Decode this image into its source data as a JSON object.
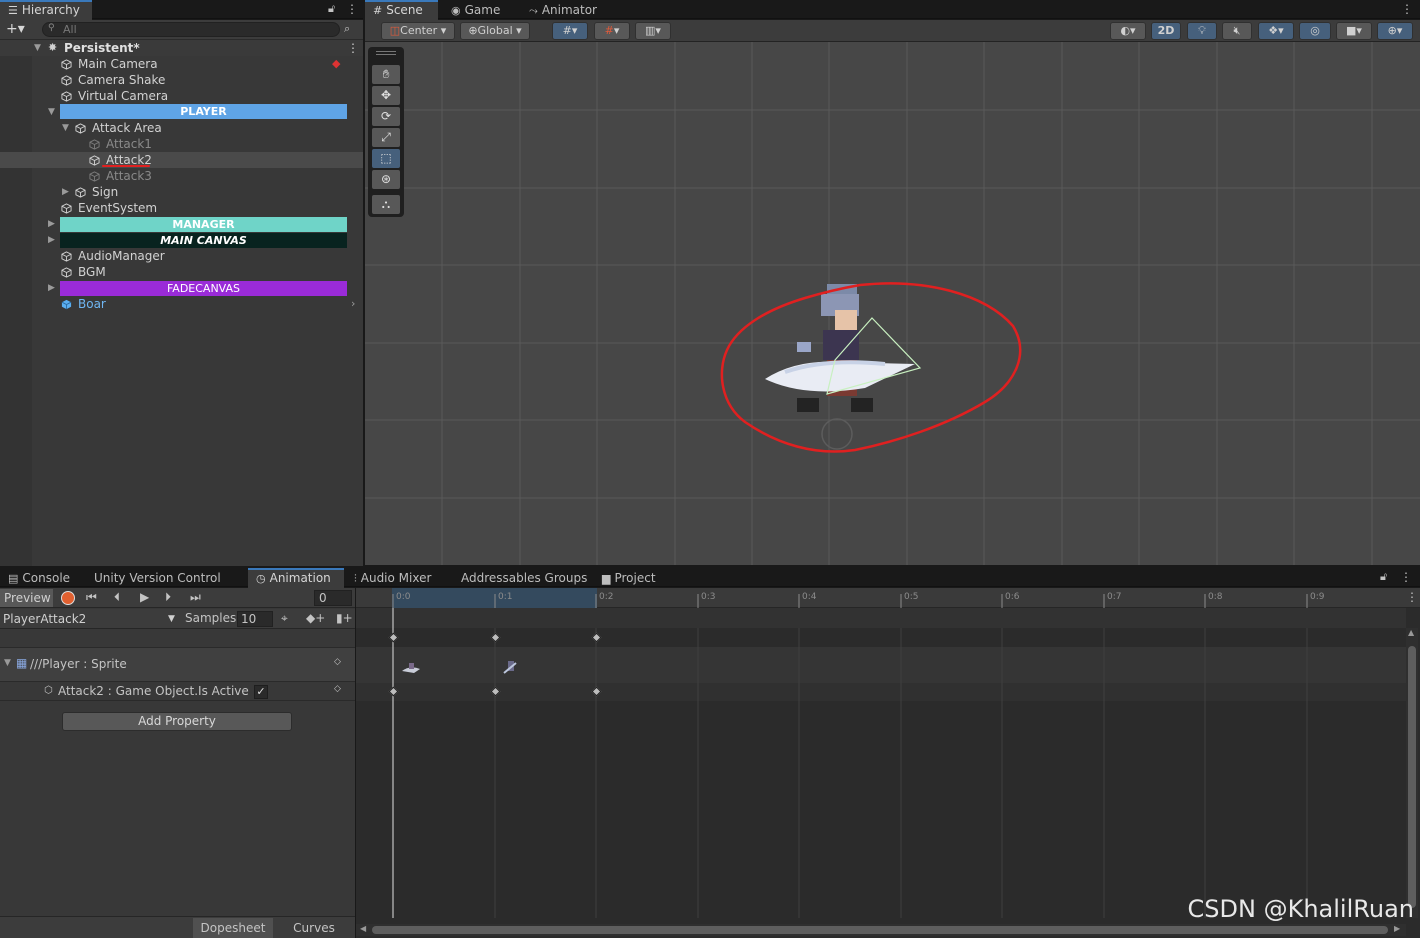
{
  "hierarchy": {
    "tab": "Hierarchy",
    "search_placeholder": "All",
    "scene_name": "Persistent*",
    "items": [
      {
        "label": "Main Camera"
      },
      {
        "label": "Camera Shake"
      },
      {
        "label": "Virtual Camera"
      },
      {
        "label": "PLAYER"
      },
      {
        "label": "Attack Area"
      },
      {
        "label": "Attack1"
      },
      {
        "label": "Attack2"
      },
      {
        "label": "Attack3"
      },
      {
        "label": "Sign"
      },
      {
        "label": "EventSystem"
      },
      {
        "label": "MANAGER"
      },
      {
        "label": "MAIN CANVAS"
      },
      {
        "label": "AudioManager"
      },
      {
        "label": "BGM"
      },
      {
        "label": "FADECANVAS"
      },
      {
        "label": "Boar"
      }
    ]
  },
  "scene_tabs": [
    "Scene",
    "Game",
    "Animator"
  ],
  "scene_toolbar": {
    "pivot": "Center",
    "space": "Global",
    "mode_2d": "2D"
  },
  "bottom_tabs": [
    "Console",
    "Unity Version Control",
    "Animation",
    "Audio Mixer",
    "Addressables Groups",
    "Project"
  ],
  "animation": {
    "preview_label": "Preview",
    "frame": "0",
    "clip": "PlayerAttack2",
    "samples_label": "Samples",
    "samples": "10",
    "properties": [
      {
        "label": "///Player : Sprite"
      },
      {
        "label": "Attack2 : Game Object.Is Active"
      }
    ],
    "add_property": "Add Property",
    "dopesheet": "Dopesheet",
    "curves": "Curves",
    "ticks": [
      "0:0",
      "0:1",
      "0:2",
      "0:3",
      "0:4",
      "0:5",
      "0:6",
      "0:7",
      "0:8",
      "0:9"
    ]
  },
  "watermark": "CSDN @KhalilRuan",
  "colors": {
    "player": "#5fa4e6",
    "manager": "#6fd4c8",
    "maincanvas": "#08231f",
    "fadecanvas": "#9a2bd8",
    "selection": "#46607c",
    "annotation": "#e02020"
  }
}
